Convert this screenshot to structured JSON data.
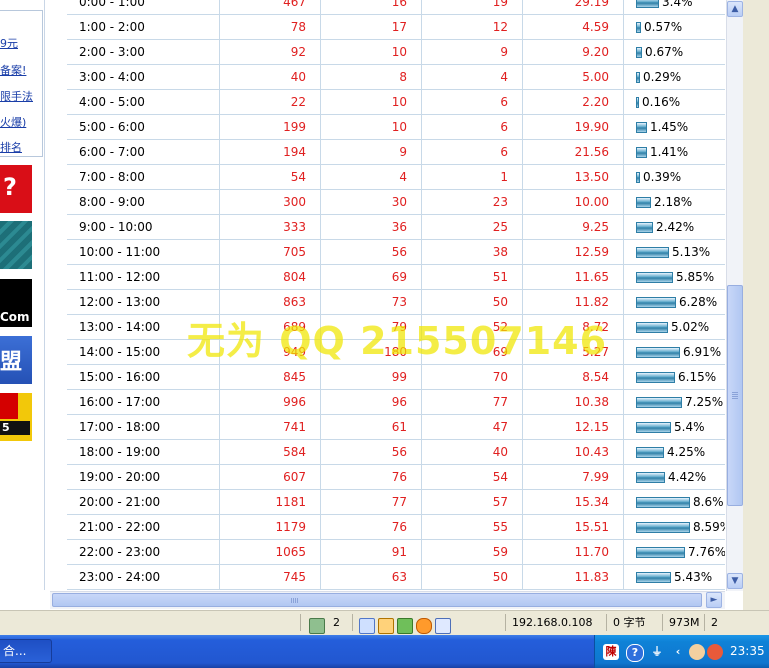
{
  "left_links": [
    "9元",
    "备案!",
    "限手法",
    "火爆)",
    "排名"
  ],
  "ads": [
    {
      "name": "ad-red",
      "text": "?"
    },
    {
      "name": "ad-teal",
      "text": ""
    },
    {
      "name": "ad-black",
      "text": "Com"
    },
    {
      "name": "ad-blue",
      "text": "盟"
    },
    {
      "name": "ad-yellow",
      "text": "5"
    }
  ],
  "table": {
    "rows": [
      {
        "time": "0:00 - 1:00",
        "c1": "467",
        "c2": "16",
        "c3": "19",
        "c4": "29.19",
        "pct": "3.4%",
        "frac": 0.034
      },
      {
        "time": "1:00 - 2:00",
        "c1": "78",
        "c2": "17",
        "c3": "12",
        "c4": "4.59",
        "pct": "0.57%",
        "frac": 0.0057
      },
      {
        "time": "2:00 - 3:00",
        "c1": "92",
        "c2": "10",
        "c3": "9",
        "c4": "9.20",
        "pct": "0.67%",
        "frac": 0.0067
      },
      {
        "time": "3:00 - 4:00",
        "c1": "40",
        "c2": "8",
        "c3": "4",
        "c4": "5.00",
        "pct": "0.29%",
        "frac": 0.0029
      },
      {
        "time": "4:00 - 5:00",
        "c1": "22",
        "c2": "10",
        "c3": "6",
        "c4": "2.20",
        "pct": "0.16%",
        "frac": 0.0016
      },
      {
        "time": "5:00 - 6:00",
        "c1": "199",
        "c2": "10",
        "c3": "6",
        "c4": "19.90",
        "pct": "1.45%",
        "frac": 0.0145
      },
      {
        "time": "6:00 - 7:00",
        "c1": "194",
        "c2": "9",
        "c3": "6",
        "c4": "21.56",
        "pct": "1.41%",
        "frac": 0.0141
      },
      {
        "time": "7:00 - 8:00",
        "c1": "54",
        "c2": "4",
        "c3": "1",
        "c4": "13.50",
        "pct": "0.39%",
        "frac": 0.0039
      },
      {
        "time": "8:00 - 9:00",
        "c1": "300",
        "c2": "30",
        "c3": "23",
        "c4": "10.00",
        "pct": "2.18%",
        "frac": 0.0218
      },
      {
        "time": "9:00 - 10:00",
        "c1": "333",
        "c2": "36",
        "c3": "25",
        "c4": "9.25",
        "pct": "2.42%",
        "frac": 0.0242
      },
      {
        "time": "10:00 - 11:00",
        "c1": "705",
        "c2": "56",
        "c3": "38",
        "c4": "12.59",
        "pct": "5.13%",
        "frac": 0.0513
      },
      {
        "time": "11:00 - 12:00",
        "c1": "804",
        "c2": "69",
        "c3": "51",
        "c4": "11.65",
        "pct": "5.85%",
        "frac": 0.0585
      },
      {
        "time": "12:00 - 13:00",
        "c1": "863",
        "c2": "73",
        "c3": "50",
        "c4": "11.82",
        "pct": "6.28%",
        "frac": 0.0628
      },
      {
        "time": "13:00 - 14:00",
        "c1": "689",
        "c2": "79",
        "c3": "52",
        "c4": "8.72",
        "pct": "5.02%",
        "frac": 0.0502
      },
      {
        "time": "14:00 - 15:00",
        "c1": "949",
        "c2": "180",
        "c3": "69",
        "c4": "5.27",
        "pct": "6.91%",
        "frac": 0.0691
      },
      {
        "time": "15:00 - 16:00",
        "c1": "845",
        "c2": "99",
        "c3": "70",
        "c4": "8.54",
        "pct": "6.15%",
        "frac": 0.0615
      },
      {
        "time": "16:00 - 17:00",
        "c1": "996",
        "c2": "96",
        "c3": "77",
        "c4": "10.38",
        "pct": "7.25%",
        "frac": 0.0725
      },
      {
        "time": "17:00 - 18:00",
        "c1": "741",
        "c2": "61",
        "c3": "47",
        "c4": "12.15",
        "pct": "5.4%",
        "frac": 0.054
      },
      {
        "time": "18:00 - 19:00",
        "c1": "584",
        "c2": "56",
        "c3": "40",
        "c4": "10.43",
        "pct": "4.25%",
        "frac": 0.0425
      },
      {
        "time": "19:00 - 20:00",
        "c1": "607",
        "c2": "76",
        "c3": "54",
        "c4": "7.99",
        "pct": "4.42%",
        "frac": 0.0442
      },
      {
        "time": "20:00 - 21:00",
        "c1": "1181",
        "c2": "77",
        "c3": "57",
        "c4": "15.34",
        "pct": "8.6%",
        "frac": 0.086
      },
      {
        "time": "21:00 - 22:00",
        "c1": "1179",
        "c2": "76",
        "c3": "55",
        "c4": "15.51",
        "pct": "8.59%",
        "frac": 0.0859
      },
      {
        "time": "22:00 - 23:00",
        "c1": "1065",
        "c2": "91",
        "c3": "59",
        "c4": "11.70",
        "pct": "7.76%",
        "frac": 0.0776
      },
      {
        "time": "23:00 - 24:00",
        "c1": "745",
        "c2": "63",
        "c3": "50",
        "c4": "11.83",
        "pct": "5.43%",
        "frac": 0.0543
      }
    ]
  },
  "watermark": "无为 QQ 215507146",
  "statusbar": {
    "count": "2",
    "ip": "192.168.0.108",
    "bytes": "0 字节",
    "memory": "973M",
    "extra": "2"
  },
  "taskbar": {
    "task_label": "合...",
    "ime_char": "陳",
    "clock": "23:35"
  },
  "colors": {
    "number_text": "#e02020",
    "grid_line": "#c8d9e8",
    "bar": "#2e7ea6",
    "taskbar": "#245edb",
    "tray": "#0e76cf",
    "watermark": "#f0e600"
  },
  "icons": [
    "scrollbar-up-arrow-icon",
    "scrollbar-down-arrow-icon",
    "scrollbar-right-arrow-icon",
    "trash-icon",
    "refresh-icon",
    "cookie-icon",
    "tree-icon",
    "gear-icon",
    "mail-icon",
    "help-icon",
    "arrow-left-icon",
    "users-icon",
    "bell-icon"
  ]
}
